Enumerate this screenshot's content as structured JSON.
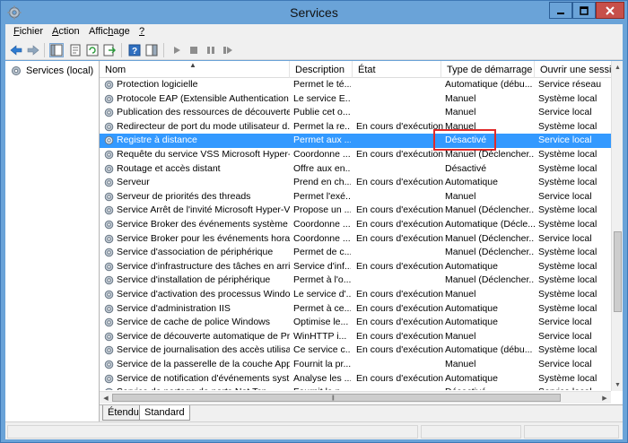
{
  "window": {
    "title": "Services"
  },
  "menu": [
    {
      "label": "Fichier",
      "accel": "F",
      "rest": "ichier"
    },
    {
      "label": "Action",
      "accel": "A",
      "rest": "ction"
    },
    {
      "label": "Affichage",
      "pre": "Affic",
      "accel": "h",
      "rest": "age"
    },
    {
      "label": "?",
      "accel": "?",
      "rest": ""
    }
  ],
  "tree": {
    "label": "Services (local)"
  },
  "columns": [
    {
      "label": "Nom"
    },
    {
      "label": "Description"
    },
    {
      "label": "État"
    },
    {
      "label": "Type de démarrage"
    },
    {
      "label": "Ouvrir une session en tant que"
    }
  ],
  "rows": [
    {
      "name": "Protection logicielle",
      "desc": "Permet le té...",
      "state": "",
      "start": "Automatique (débu...",
      "logon": "Service réseau"
    },
    {
      "name": "Protocole EAP (Extensible Authentication ...",
      "desc": "Le service E...",
      "state": "",
      "start": "Manuel",
      "logon": "Système local"
    },
    {
      "name": "Publication des ressources de découverte ...",
      "desc": "Publie cet o...",
      "state": "",
      "start": "Manuel",
      "logon": "Service local"
    },
    {
      "name": "Redirecteur de port du mode utilisateur d...",
      "desc": "Permet la re...",
      "state": "En cours d'exécution",
      "start": "Manuel",
      "logon": "Système local"
    },
    {
      "name": "Registre à distance",
      "desc": "Permet aux ...",
      "state": "",
      "start": "Désactivé",
      "logon": "Service local",
      "selected": true
    },
    {
      "name": "Requête du service VSS Microsoft Hyper-V",
      "desc": "Coordonne ...",
      "state": "En cours d'exécution",
      "start": "Manuel (Déclencher...",
      "logon": "Système local"
    },
    {
      "name": "Routage et accès distant",
      "desc": "Offre aux en...",
      "state": "",
      "start": "Désactivé",
      "logon": "Système local"
    },
    {
      "name": "Serveur",
      "desc": "Prend en ch...",
      "state": "En cours d'exécution",
      "start": "Automatique",
      "logon": "Système local"
    },
    {
      "name": "Serveur de priorités des threads",
      "desc": "Permet l'exé...",
      "state": "",
      "start": "Manuel",
      "logon": "Service local"
    },
    {
      "name": "Service Arrêt de l'invité Microsoft Hyper-V",
      "desc": "Propose un ...",
      "state": "En cours d'exécution",
      "start": "Manuel (Déclencher...",
      "logon": "Système local"
    },
    {
      "name": "Service Broker des événements système",
      "desc": "Coordonne ...",
      "state": "En cours d'exécution",
      "start": "Automatique (Décle...",
      "logon": "Système local"
    },
    {
      "name": "Service Broker pour les événements horaires",
      "desc": "Coordonne ...",
      "state": "En cours d'exécution",
      "start": "Manuel (Déclencher...",
      "logon": "Service local"
    },
    {
      "name": "Service d'association de périphérique",
      "desc": "Permet de c...",
      "state": "",
      "start": "Manuel (Déclencher...",
      "logon": "Système local"
    },
    {
      "name": "Service d'infrastructure des tâches en arriè...",
      "desc": "Service d'inf...",
      "state": "En cours d'exécution",
      "start": "Automatique",
      "logon": "Système local"
    },
    {
      "name": "Service d'installation de périphérique",
      "desc": "Permet à l'o...",
      "state": "",
      "start": "Manuel (Déclencher...",
      "logon": "Système local"
    },
    {
      "name": "Service d'activation des processus Windows",
      "desc": "Le service d'...",
      "state": "En cours d'exécution",
      "start": "Manuel",
      "logon": "Système local"
    },
    {
      "name": "Service d'administration IIS",
      "desc": "Permet à ce...",
      "state": "En cours d'exécution",
      "start": "Automatique",
      "logon": "Système local"
    },
    {
      "name": "Service de cache de police Windows",
      "desc": "Optimise le...",
      "state": "En cours d'exécution",
      "start": "Automatique",
      "logon": "Service local"
    },
    {
      "name": "Service de découverte automatique de Pr...",
      "desc": "WinHTTP i...",
      "state": "En cours d'exécution",
      "start": "Manuel",
      "logon": "Service local"
    },
    {
      "name": "Service de journalisation des accès utilisat...",
      "desc": "Ce service c...",
      "state": "En cours d'exécution",
      "start": "Automatique (débu...",
      "logon": "Système local"
    },
    {
      "name": "Service de la passerelle de la couche Appli...",
      "desc": "Fournit la pr...",
      "state": "",
      "start": "Manuel",
      "logon": "Service local"
    },
    {
      "name": "Service de notification d'événements syst...",
      "desc": "Analyse les ...",
      "state": "En cours d'exécution",
      "start": "Automatique",
      "logon": "Système local"
    },
    {
      "name": "Service de partage de ports Net.Tcp",
      "desc": "Fournit la p...",
      "state": "",
      "start": "Désactivé",
      "logon": "Service local"
    }
  ],
  "tabs": [
    {
      "label": "Étendu"
    },
    {
      "label": "Standard"
    }
  ],
  "colors": {
    "selection": "#3399ff",
    "highlight_box": "#e12a2a",
    "titlebar": "#6aa3d8",
    "close_button": "#c7504a"
  },
  "icons": [
    "services-app-icon",
    "minimize-icon",
    "maximize-icon",
    "close-icon",
    "back-arrow-icon",
    "forward-arrow-icon",
    "console-tree-icon",
    "properties-icon",
    "refresh-icon",
    "export-icon",
    "help-icon",
    "action-pane-icon",
    "start-service-icon",
    "stop-service-icon",
    "pause-service-icon",
    "restart-service-icon",
    "service-gear-icon",
    "sort-ascending-icon"
  ]
}
